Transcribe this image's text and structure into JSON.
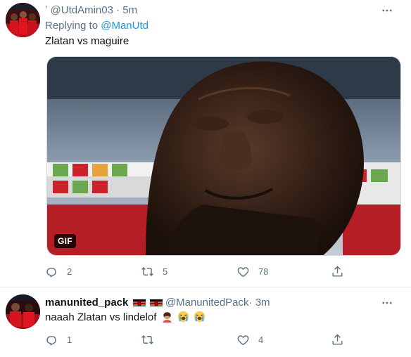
{
  "tweet1": {
    "handle": "@UtdAmin03",
    "separator": "·",
    "time": "5m",
    "replying_prefix": "Replying to",
    "replying_to": "@ManUtd",
    "text": "Zlatan vs maguire",
    "media_badge": "GIF",
    "actions": {
      "reply_count": "2",
      "retweet_count": "5",
      "like_count": "78"
    }
  },
  "tweet2": {
    "display_name": "manunited_pack",
    "handle": "@ManunitedPack",
    "separator": "·",
    "time": "3m",
    "text": "naaah Zlatan vs lindelof",
    "actions": {
      "reply_count": "1",
      "retweet_count": "",
      "like_count": "4"
    }
  },
  "icons": {
    "reply": "reply-icon",
    "retweet": "retweet-icon",
    "like": "heart-icon",
    "share": "share-icon",
    "more": "more-icon"
  },
  "colors": {
    "link": "#1b95e0",
    "muted": "#5b7083",
    "divider": "#e1e8ed"
  }
}
